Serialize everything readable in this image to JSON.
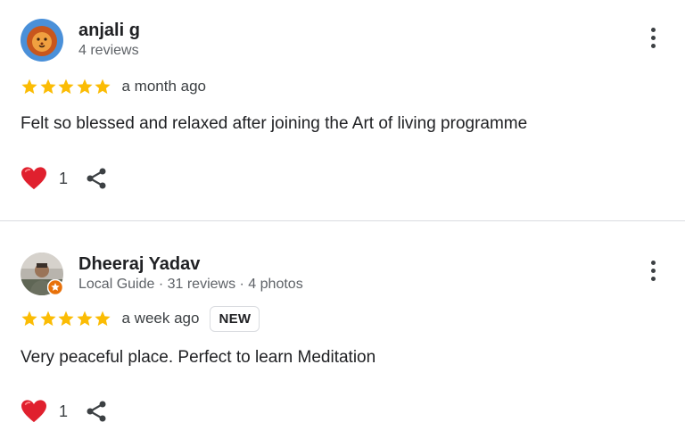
{
  "reviews": [
    {
      "author": "anjali g",
      "meta": "4 reviews",
      "avatar_icon": "lion-avatar-icon",
      "rating": 5,
      "time": "a month ago",
      "badge": "",
      "text": "Felt so blessed and relaxed after joining the Art of living programme",
      "likes": "1"
    },
    {
      "author": "Dheeraj Yadav",
      "meta": "Local Guide · 31 reviews · 4 photos",
      "avatar_icon": "profile-photo-avatar",
      "rating": 5,
      "time": "a week ago",
      "badge": "NEW",
      "text": "Very peaceful place. Perfect to learn Meditation",
      "likes": "1"
    }
  ],
  "colors": {
    "star": "#fbbc04",
    "heart": "#e0202e",
    "local_guide_badge": "#e8710a",
    "divider": "#dadce0"
  }
}
